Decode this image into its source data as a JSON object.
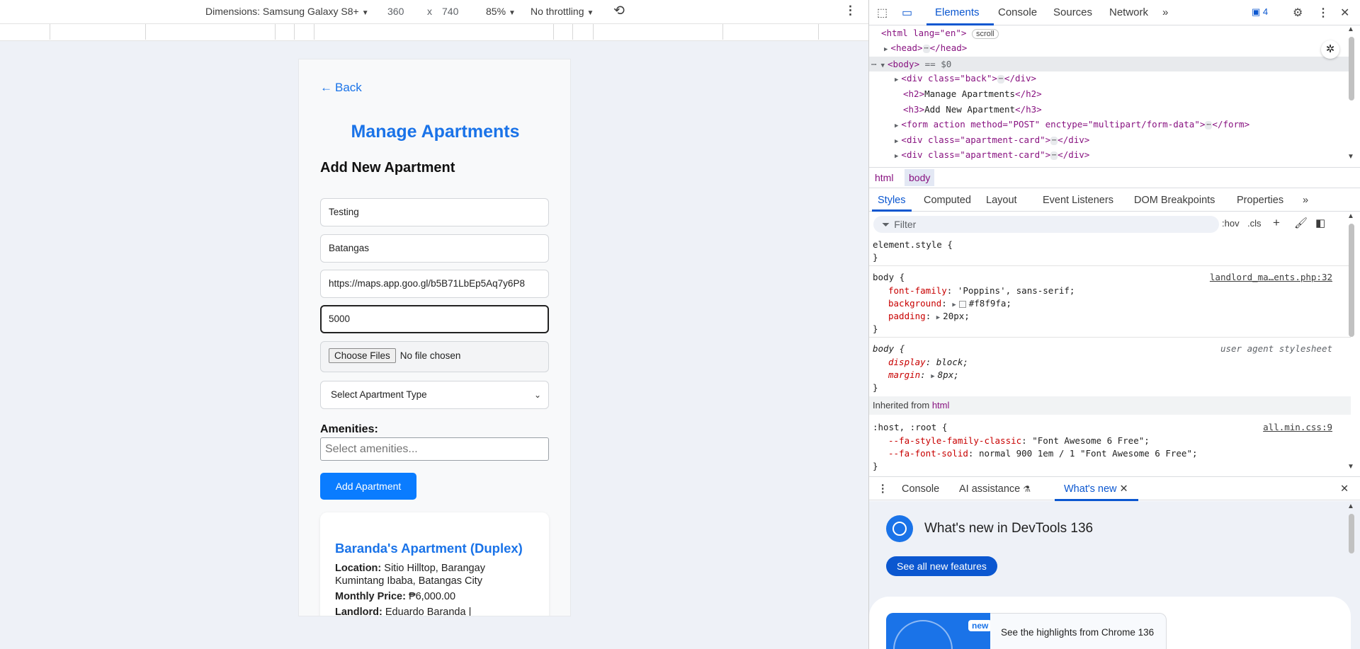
{
  "toolbar": {
    "dimensions_label": "Dimensions: Samsung Galaxy S8+",
    "width": "360",
    "times": "x",
    "height": "740",
    "zoom": "85%",
    "throttling": "No throttling"
  },
  "page": {
    "back": "Back",
    "title": "Manage Apartments",
    "subtitle": "Add New Apartment",
    "inputs": {
      "name": "Testing",
      "location": "Batangas",
      "map_url": "https://maps.app.goo.gl/b5B71LbEp5Aq7y6P8",
      "price": "5000"
    },
    "file_button": "Choose Files",
    "file_status": "No file chosen",
    "type_select": "Select Apartment Type",
    "amenities_label": "Amenities:",
    "amenities_placeholder": "Select amenities...",
    "add_button": "Add Apartment",
    "card": {
      "title": "Baranda's Apartment (Duplex)",
      "location_label": "Location:",
      "location_value": "Sitio Hilltop, Barangay Kumintang Ibaba, Batangas City",
      "price_label": "Monthly Price:",
      "price_value": "₱6,000.00",
      "landlord_label": "Landlord:",
      "landlord_value": "Eduardo Baranda |"
    }
  },
  "devtools": {
    "tabs": [
      "Elements",
      "Console",
      "Sources",
      "Network"
    ],
    "issues_count": "4",
    "dom": {
      "html_open": "<html lang=\"en\">",
      "scroll_badge": "scroll",
      "head": "<head>",
      "head_close": "</head>",
      "body": "<body>",
      "body_marker": "== $0",
      "div_back": "<div class=\"back\">",
      "div_close": "</div>",
      "h2_open": "<h2>",
      "h2_text": "Manage Apartments",
      "h2_close": "</h2>",
      "h3_open": "<h3>",
      "h3_text": "Add New Apartment",
      "h3_close": "</h3>",
      "form_open": "<form action method=\"POST\" enctype=\"multipart/form-data\">",
      "form_close": "</form>",
      "card1": "<div class=\"apartment-card\">",
      "card2": "<div class=\"apartment-card\">"
    },
    "breadcrumbs": [
      "html",
      "body"
    ],
    "sub_tabs": [
      "Styles",
      "Computed",
      "Layout",
      "Event Listeners",
      "DOM Breakpoints",
      "Properties"
    ],
    "filter_placeholder": "Filter",
    "hov": ":hov",
    "cls": ".cls",
    "styles": {
      "element_style": "element.style {",
      "close_brace": "}",
      "body_sel": "body {",
      "body_src": "landlord_ma…ents.php:32",
      "font_family_prop": "font-family",
      "font_family_val": "'Poppins', sans-serif;",
      "background_prop": "background",
      "background_val": "#f8f9fa;",
      "padding_prop": "padding",
      "padding_val": "20px;",
      "ua_body_sel": "body {",
      "ua_src": "user agent stylesheet",
      "display_prop": "display",
      "display_val": "block;",
      "margin_prop": "margin",
      "margin_val": "8px;",
      "inherited_label": "Inherited from",
      "inherited_from": "html",
      "host_sel": ":host, :root {",
      "host_src": "all.min.css:9",
      "fa_classic_prop": "--fa-style-family-classic",
      "fa_classic_val": "\"Font Awesome 6 Free\";",
      "fa_solid_prop": "--fa-font-solid",
      "fa_solid_val": "normal 900 1em / 1 \"Font Awesome 6 Free\";"
    },
    "drawer_tabs": [
      "Console",
      "AI assistance",
      "What's new"
    ],
    "whats_new": {
      "title": "What's new in DevTools 136",
      "button": "See all new features",
      "badge": "new",
      "highlights": "See the highlights from Chrome 136"
    }
  }
}
